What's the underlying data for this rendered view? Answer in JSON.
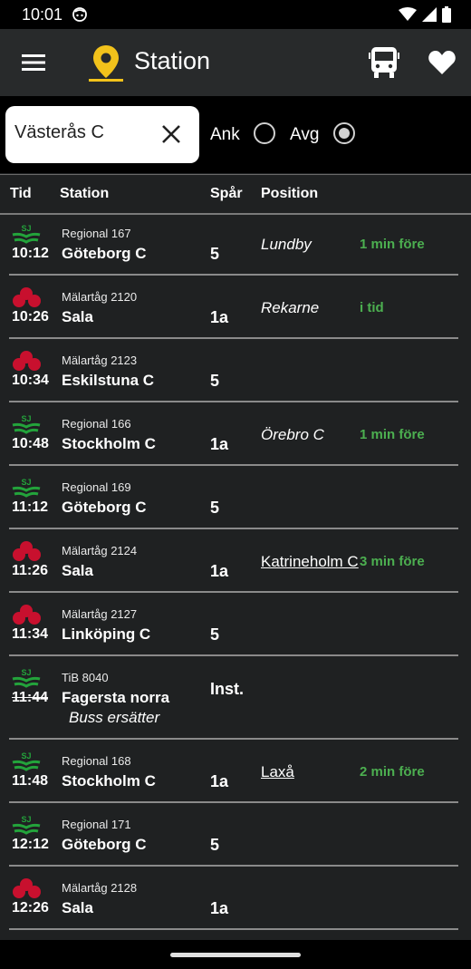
{
  "status_bar": {
    "time": "10:01"
  },
  "app_bar": {
    "title": "Station"
  },
  "search": {
    "value": "Västerås C",
    "placeholder": ""
  },
  "filters": {
    "arrivals_label": "Ank",
    "departures_label": "Avg",
    "selected": "Avg"
  },
  "columns": {
    "time": "Tid",
    "station": "Station",
    "track": "Spår",
    "position": "Position"
  },
  "colors": {
    "sj_green": "#23a33b",
    "malartag_red": "#c8102e",
    "on_time_green": "#4caf50"
  },
  "rows": [
    {
      "operator": "SJ",
      "time": "10:12",
      "train": "Regional 167",
      "destination": "Göteborg C",
      "track": "5",
      "position": "Lundby",
      "status": "1 min före"
    },
    {
      "operator": "Mälartåg",
      "time": "10:26",
      "train": "Mälartåg 2120",
      "destination": "Sala",
      "track": "1a",
      "position": "Rekarne",
      "status": "i tid"
    },
    {
      "operator": "Mälartåg",
      "time": "10:34",
      "train": "Mälartåg 2123",
      "destination": "Eskilstuna C",
      "track": "5",
      "position": "",
      "status": ""
    },
    {
      "operator": "SJ",
      "time": "10:48",
      "train": "Regional 166",
      "destination": "Stockholm C",
      "track": "1a",
      "position": "Örebro C",
      "status": "1 min före"
    },
    {
      "operator": "SJ",
      "time": "11:12",
      "train": "Regional 169",
      "destination": "Göteborg C",
      "track": "5",
      "position": "",
      "status": ""
    },
    {
      "operator": "Mälartåg",
      "time": "11:26",
      "train": "Mälartåg 2124",
      "destination": "Sala",
      "track": "1a",
      "position": "Katrineholm C",
      "status": "3 min före"
    },
    {
      "operator": "Mälartåg",
      "time": "11:34",
      "train": "Mälartåg 2127",
      "destination": "Linköping C",
      "track": "5",
      "position": "",
      "status": ""
    },
    {
      "operator": "SJ",
      "time": "11:44",
      "train": "TiB 8040",
      "destination": "Fagersta norra",
      "note": "Buss ersätter",
      "track": "Inst.",
      "position": "",
      "status": ""
    },
    {
      "operator": "SJ",
      "time": "11:48",
      "train": "Regional 168",
      "destination": "Stockholm C",
      "track": "1a",
      "position": "Laxå",
      "status": "2 min före"
    },
    {
      "operator": "SJ",
      "time": "12:12",
      "train": "Regional 171",
      "destination": "Göteborg C",
      "track": "5",
      "position": "",
      "status": ""
    },
    {
      "operator": "Mälartåg",
      "time": "12:26",
      "train": "Mälartåg 2128",
      "destination": "Sala",
      "track": "1a",
      "position": "",
      "status": ""
    }
  ]
}
